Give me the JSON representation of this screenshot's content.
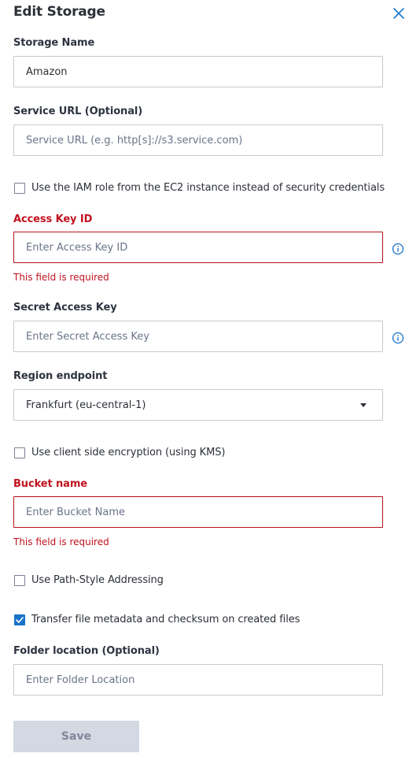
{
  "header": {
    "title": "Edit Storage"
  },
  "colors": {
    "error": "#c1121f",
    "accent": "#1a73c9",
    "border": "#c7cad1",
    "save_bg": "#d3d8e3"
  },
  "storage_name": {
    "label": "Storage Name",
    "value": "Amazon"
  },
  "service_url": {
    "label": "Service URL (Optional)",
    "placeholder": "Service URL (e.g. http[s]://s3.service.com)"
  },
  "iam_role": {
    "label": "Use the IAM role from the EC2 instance instead of security credentials",
    "checked": false
  },
  "access_key": {
    "label": "Access Key ID",
    "placeholder": "Enter Access Key ID",
    "error": "This field is required",
    "icon": "info-icon"
  },
  "secret_key": {
    "label": "Secret Access Key",
    "placeholder": "Enter Secret Access Key",
    "icon": "info-icon"
  },
  "region": {
    "label": "Region endpoint",
    "value": "Frankfurt (eu-central-1)"
  },
  "client_encryption": {
    "label": "Use client side encryption (using KMS)",
    "checked": false
  },
  "bucket": {
    "label": "Bucket name",
    "placeholder": "Enter Bucket Name",
    "error": "This field is required"
  },
  "path_style": {
    "label": "Use Path-Style Addressing",
    "checked": false
  },
  "metadata": {
    "label": "Transfer file metadata and checksum on created files",
    "checked": true
  },
  "folder": {
    "label": "Folder location (Optional)",
    "placeholder": "Enter Folder Location"
  },
  "save": {
    "label": "Save"
  }
}
